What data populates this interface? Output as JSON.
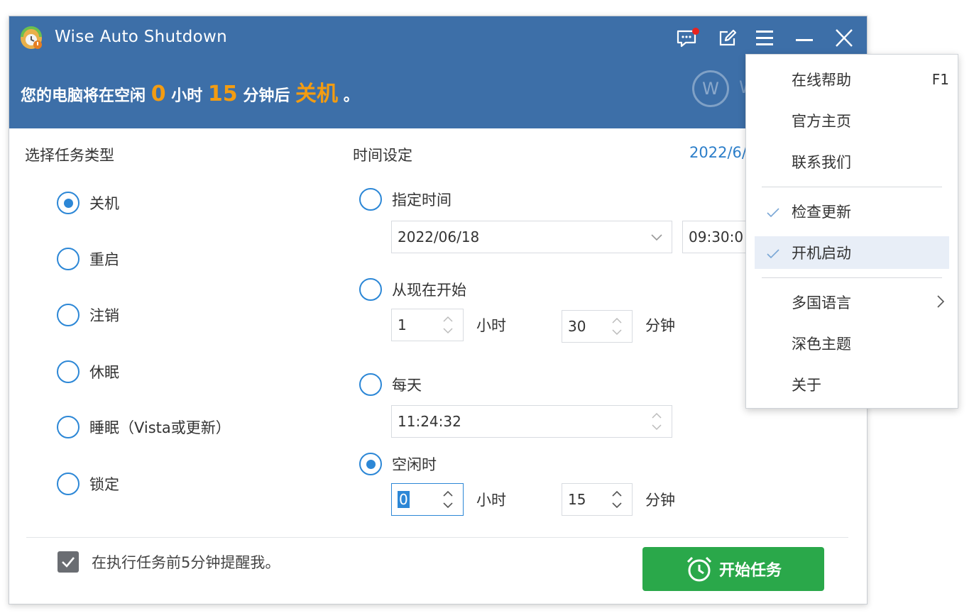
{
  "app": {
    "title": "Wise Auto Shutdown"
  },
  "status": {
    "prefix": "您的电脑将在空闲",
    "hours": "0",
    "hours_unit": "小时",
    "minutes": "15",
    "minutes_unit": "分钟后",
    "action": "关机",
    "suffix": "。"
  },
  "task_type": {
    "title": "选择任务类型",
    "options": [
      "关机",
      "重启",
      "注销",
      "休眠",
      "睡眠（Vista或更新）",
      "锁定"
    ],
    "selected_index": 0
  },
  "time_settings": {
    "title": "时间设定",
    "date_display": "2022/6/",
    "specified": {
      "label": "指定时间",
      "date": "2022/06/18",
      "time": "09:30:0"
    },
    "from_now": {
      "label": "从现在开始",
      "hours": "1",
      "hours_unit": "小时",
      "minutes": "30",
      "minutes_unit": "分钟"
    },
    "daily": {
      "label": "每天",
      "time": "11:24:32"
    },
    "idle": {
      "label": "空闲时",
      "hours": "0",
      "hours_unit": "小时",
      "minutes": "15",
      "minutes_unit": "分钟"
    },
    "selected": "idle"
  },
  "footer": {
    "remind_label": "在执行任务前5分钟提醒我。",
    "remind_checked": true,
    "start_button": "开始任务"
  },
  "menu": {
    "items": [
      {
        "label": "在线帮助",
        "shortcut": "F1",
        "checked": false
      },
      {
        "label": "官方主页",
        "checked": false
      },
      {
        "label": "联系我们",
        "checked": false
      },
      {
        "label": "检查更新",
        "checked": true
      },
      {
        "label": "开机启动",
        "checked": true,
        "highlighted": true
      },
      {
        "label": "多国语言",
        "submenu": true,
        "checked": false
      },
      {
        "label": "深色主题",
        "checked": false
      },
      {
        "label": "关于",
        "checked": false
      }
    ]
  },
  "colors": {
    "header_bg": "#3d6fa8",
    "accent_orange": "#f39c12",
    "radio_blue": "#2c87d6",
    "start_green": "#2aa84a",
    "notification_red": "#e8231f"
  }
}
